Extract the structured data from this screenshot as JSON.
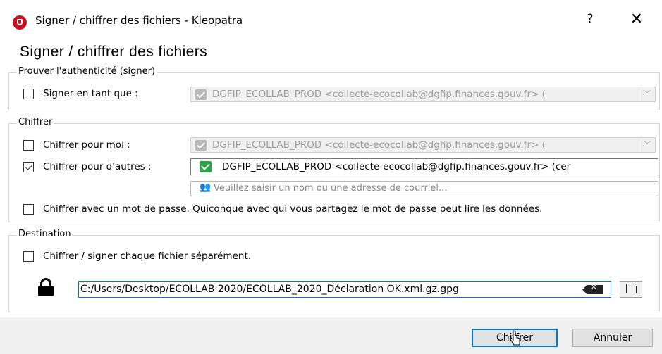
{
  "window": {
    "title": "Signer / chiffrer des fichiers - Kleopatra",
    "help_label": "?",
    "close_label": "✕"
  },
  "heading": "Signer / chiffrer des fichiers",
  "sign": {
    "legend": "Prouver l'authenticité (signer)",
    "sign_as_label": "Signer en tant que :",
    "sign_as_checked": false,
    "sign_as_value": "DGFIP_ECOLLAB_PROD <collecte-ecocollab@dgfip.finances.gouv.fr> ("
  },
  "encrypt": {
    "legend": "Chiffrer",
    "for_me_label": "Chiffrer pour moi :",
    "for_me_checked": false,
    "for_me_value": "DGFIP_ECOLLAB_PROD <collecte-ecocollab@dgfip.finances.gouv.fr> (",
    "for_others_label": "Chiffrer pour d'autres :",
    "for_others_checked": true,
    "recipient_value": "DGFIP_ECOLLAB_PROD <collecte-ecocollab@dgfip.finances.gouv.fr> (cer",
    "add_recipient_placeholder": "Veuillez saisir un nom ou une adresse de courriel...",
    "password_label": "Chiffrer avec un mot de passe. Quiconque avec qui vous partagez le mot de passe peut lire les données.",
    "password_checked": false
  },
  "destination": {
    "legend": "Destination",
    "separate_label": "Chiffrer / signer chaque fichier séparément.",
    "separate_checked": false,
    "output_path": "C:/Users/Desktop/ECOLLAB 2020/ECOLLAB_2020_Déclaration OK.xml.gz.gpg"
  },
  "buttons": {
    "encrypt_label": "Chiffrer",
    "cancel_label": "Annuler"
  },
  "icons": {
    "app": "kleopatra-icon",
    "lock": "lock-icon",
    "clear": "backspace-clear-icon",
    "browse": "folder-icon",
    "add_recipient": "add-user-icon"
  }
}
